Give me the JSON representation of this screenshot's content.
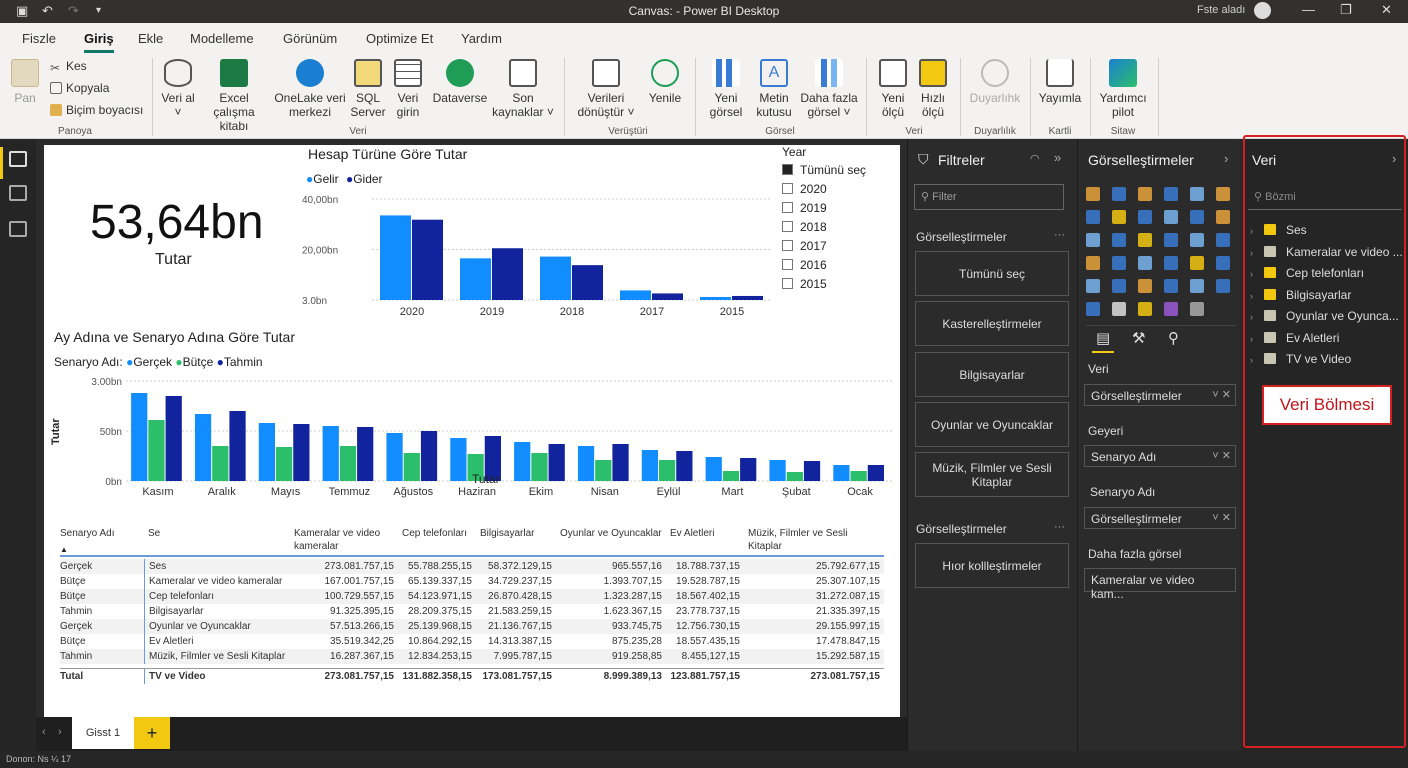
{
  "titlebar": {
    "title": "Canvas:  - Power BI Desktop",
    "user": "Fste aladı"
  },
  "menu": {
    "tabs": [
      "Fiszle",
      "Giriş",
      "Ekle",
      "Modelleme",
      "Görünüm",
      "Optimize Et",
      "Yardım"
    ],
    "active": "Giriş"
  },
  "ribbon": {
    "paste": "Pan",
    "clipboard": {
      "cut": "Kes",
      "copy": "Kopyala",
      "format": "Biçim boyacısı",
      "group": "Panoya"
    },
    "data": {
      "get": "Veri al ˅",
      "excel": "Excel çalışma kitabı",
      "onelake": "OneLake veri merkezi",
      "sql": "SQL Server",
      "enter": "Veri girin",
      "dataverse": "Dataverse",
      "recent": "Son kaynaklar ˅",
      "group": "Veri"
    },
    "queries": {
      "transform": "Verileri dönüştür ˅",
      "refresh": "Yenile",
      "group": "Verüştüri"
    },
    "visual": {
      "new": "Yeni görsel",
      "textbox": "Metin kutusu",
      "more": "Daha fazla görsel ˅",
      "group": "Görsel"
    },
    "calc": {
      "measure": "Yeni ölçü",
      "quick": "Hızlı ölçü",
      "group": "Veri"
    },
    "sensitivity": {
      "label": "Duyarlıhk",
      "group": "Duyarlılık"
    },
    "share": {
      "publish": "Yayımla",
      "group": "Kartli"
    },
    "copilot": {
      "label": "Yardımcı pilot",
      "group": "Sitaw"
    }
  },
  "card": {
    "value": "53,64bn",
    "label": "Tutar"
  },
  "chart1": {
    "chart_data": {
      "type": "bar",
      "title": "Hesap Türüne Göre Tutar",
      "categories": [
        "2020",
        "2019",
        "2018",
        "2017",
        "2015"
      ],
      "series": [
        {
          "name": "Gelir",
          "values": [
            33.5,
            16.5,
            17.2,
            3.8,
            1.2
          ]
        },
        {
          "name": "Gider",
          "values": [
            31.8,
            20.5,
            13.8,
            2.6,
            1.6
          ]
        }
      ],
      "yticks": [
        "40,00bn",
        "20,00bn",
        "3.0bn"
      ],
      "ylim": [
        0,
        40
      ],
      "colors": [
        "#118dff",
        "#12239e"
      ]
    }
  },
  "slicer": {
    "title": "Year",
    "items": [
      "Tümünü seç",
      "2020",
      "2019",
      "2018",
      "2017",
      "2016",
      "2015"
    ]
  },
  "chart2": {
    "chart_data": {
      "type": "bar",
      "title": "Ay Adına ve Senaryo Adına Göre Tutar",
      "legend_title": "Senaryo Adı:",
      "xlabel": "Tutar",
      "ylabel": "Tutar",
      "categories": [
        "Kasım",
        "Aralık",
        "Mayıs",
        "Temmuz",
        "Ağustos",
        "Haziran",
        "Ekim",
        "Nisan",
        "Eylül",
        "Mart",
        "Şubat",
        "Ocak"
      ],
      "series": [
        {
          "name": "Gerçek",
          "values": [
            88,
            67,
            58,
            55,
            48,
            43,
            39,
            35,
            31,
            24,
            21,
            16
          ]
        },
        {
          "name": "Bütçe",
          "values": [
            61,
            35,
            34,
            35,
            28,
            27,
            28,
            21,
            21,
            10,
            9,
            10
          ]
        },
        {
          "name": "Tahmin",
          "values": [
            85,
            70,
            57,
            54,
            50,
            45,
            37,
            37,
            30,
            23,
            20,
            16
          ]
        }
      ],
      "yticks": [
        "3.00bn",
        "50bn",
        "0bn"
      ],
      "ylim": [
        0,
        100
      ],
      "colors": [
        "#118dff",
        "#2bbf6b",
        "#12239e"
      ]
    }
  },
  "table": {
    "headers": [
      "Senaryo Adı",
      "Se",
      "Kameralar ve video kameralar",
      "Cep telefonları",
      "Bilgisayarlar",
      "Oyunlar ve Oyuncaklar",
      "Ev Aletleri",
      "Müzik, Filmler ve Sesli Kitaplar"
    ],
    "rows": [
      [
        "Gerçek",
        "Ses",
        "273.081.757,15",
        "55.788.255,15",
        "58.372.129,15",
        "965.557,16",
        "18.788.737,15",
        "25.792.677,15"
      ],
      [
        "Bütçe",
        "Kameralar ve video kameralar",
        "167.001.757,15",
        "65.139.337,15",
        "34.729.237,15",
        "1.393.707,15",
        "19.528.787,15",
        "25.307.107,15"
      ],
      [
        "Bütçe",
        "Cep telefonları",
        "100.729.557,15",
        "54.123.971,15",
        "26.870.428,15",
        "1.323.287,15",
        "18.567.402,15",
        "31.272.087,15"
      ],
      [
        "Tahmin",
        "Bilgisayarlar",
        "91.325.395,15",
        "28.209.375,15",
        "21.583.259,15",
        "1.623.367,15",
        "23.778.737,15",
        "21.335.397,15"
      ],
      [
        "Gerçek",
        "Oyunlar ve Oyuncaklar",
        "57.513.266,15",
        "25.139.968,15",
        "21.136.767,15",
        "933.745,75",
        "12.756.730,15",
        "29.155.997,15"
      ],
      [
        "Bütçe",
        "Ev Aletleri",
        "35.519.342,25",
        "10.864.292,15",
        "14.313.387,15",
        "875.235,28",
        "18.557.435,15",
        "17.478.847,15"
      ],
      [
        "Tahmin",
        "Müzik, Filmler ve Sesli Kitaplar",
        "16.287.367,15",
        "12.834.253,15",
        "7.995.787,15",
        "919.258,85",
        "8.455,127,15",
        "15.292.587,15"
      ]
    ],
    "total": [
      "Tutal",
      "TV ve Video",
      "273.081.757,15",
      "131.882.358,15",
      "173.081.757,15",
      "8.999.389,13",
      "123.881.757,15",
      "273.081.757,15"
    ]
  },
  "filters": {
    "title": "Filtreler",
    "search_placeholder": "Filter",
    "section1": "Görselleştirmeler",
    "buttons": [
      "Tümünü seç",
      "Kasterelleştirmeler",
      "Bilgisayarlar",
      "Oyunlar ve Oyuncaklar",
      "Müzik, Filmler ve Sesli Kitaplar"
    ],
    "section2": "Görselleştirmeler",
    "button6": "Hıor kollleştirmeler"
  },
  "viz": {
    "title": "Görselleştirmeler",
    "wells": [
      {
        "label": "Veri",
        "value": "Görselleştirmeler"
      },
      {
        "label": "Geyeri",
        "value": "Senaryo Adı"
      },
      {
        "label": "Senaryo Adı",
        "value": "Görselleştirmeler"
      }
    ],
    "more_label": "Daha fazla görsel",
    "more_value": "Kameralar ve video kam..."
  },
  "datapane": {
    "title": "Veri",
    "search_placeholder": "Bözmi",
    "fields": [
      "Ses",
      "Kameralar ve video ...",
      "Cep telefonları",
      "Bilgisayarlar",
      "Oyunlar ve Oyunca...",
      "Ev Aletleri",
      "TV ve Video"
    ],
    "callout": "Veri Bölmesi"
  },
  "tabs": {
    "page1": "Gisst 1",
    "add": "+"
  },
  "status": {
    "text": "Donon: Ns ¼ 17"
  }
}
